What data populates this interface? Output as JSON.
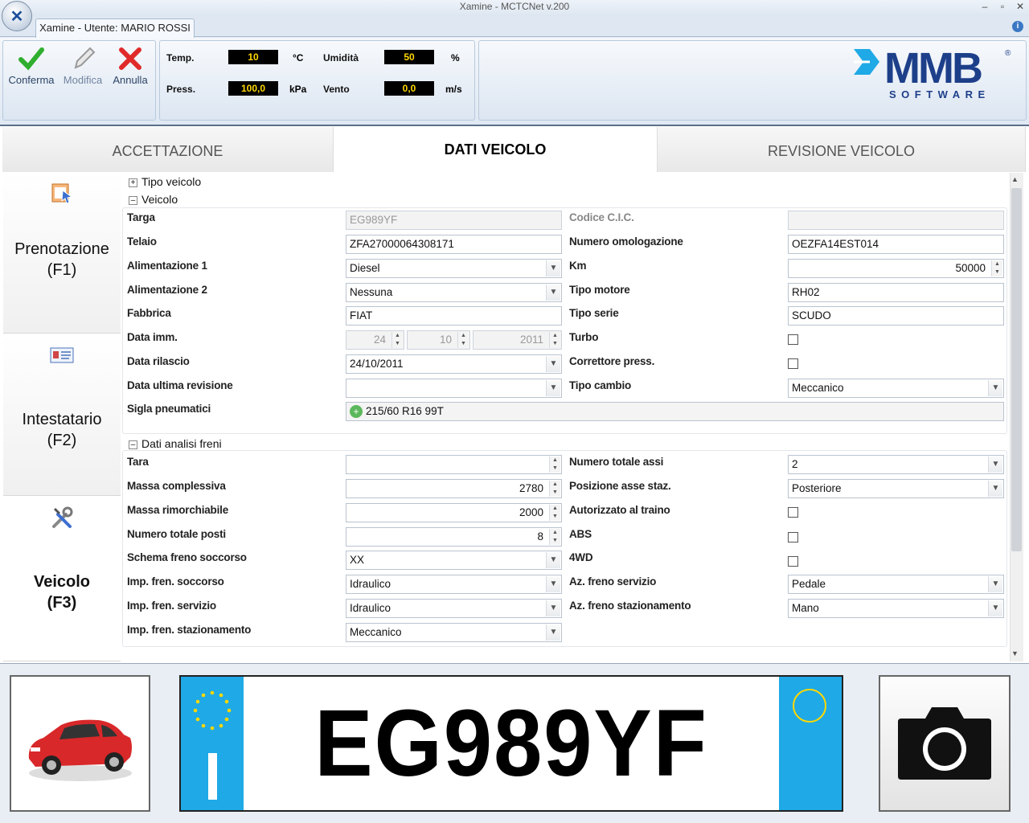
{
  "window": {
    "title": "Xamine - MCTCNet v.200",
    "user_tab": "Xamine - Utente: MARIO ROSSI"
  },
  "ribbon": {
    "confirm_label": "Conferma",
    "edit_label": "Modifica",
    "cancel_label": "Annulla",
    "temp_label": "Temp.",
    "temp_value": "10",
    "temp_unit": "°C",
    "press_label": "Press.",
    "press_value": "100,0",
    "press_unit": "kPa",
    "humidity_label": "Umidità",
    "humidity_value": "50",
    "humidity_unit": "%",
    "wind_label": "Vento",
    "wind_value": "0,0",
    "wind_unit": "m/s"
  },
  "logo": {
    "brand": "MMB",
    "sub": "SOFTWARE"
  },
  "tabs": [
    "ACCETTAZIONE",
    "DATI VEICOLO",
    "REVISIONE VEICOLO"
  ],
  "side": {
    "item1_line1": "Prenotazione",
    "item1_line2": "(F1)",
    "item2_line1": "Intestatario",
    "item2_line2": "(F2)",
    "item3_line1": "Veicolo",
    "item3_line2": "(F3)"
  },
  "sections": {
    "tipo_veicolo": "Tipo veicolo",
    "veicolo": "Veicolo",
    "freni": "Dati analisi freni"
  },
  "veicolo": {
    "targa_label": "Targa",
    "targa": "EG989YF",
    "telaio_label": "Telaio",
    "telaio": "ZFA27000064308171",
    "alim1_label": "Alimentazione 1",
    "alim1": "Diesel",
    "alim2_label": "Alimentazione 2",
    "alim2": "Nessuna",
    "fabbrica_label": "Fabbrica",
    "fabbrica": "FIAT",
    "data_imm_label": "Data imm.",
    "data_imm_d": "24",
    "data_imm_m": "10",
    "data_imm_y": "2011",
    "data_ril_label": "Data rilascio",
    "data_ril": "24/10/2011",
    "data_rev_label": "Data ultima revisione",
    "data_rev": "",
    "pneumatici_label": "Sigla pneumatici",
    "pneumatici": "215/60 R16 99T",
    "cic_label": "Codice C.I.C.",
    "cic": "",
    "omolog_label": "Numero omologazione",
    "omolog": "OEZFA14EST014",
    "km_label": "Km",
    "km": "50000",
    "motore_label": "Tipo motore",
    "motore": "RH02",
    "serie_label": "Tipo serie",
    "serie": "SCUDO",
    "turbo_label": "Turbo",
    "correttore_label": "Correttore press.",
    "cambio_label": "Tipo cambio",
    "cambio": "Meccanico"
  },
  "freni": {
    "tara_label": "Tara",
    "tara": "",
    "massa_label": "Massa complessiva",
    "massa": "2780",
    "rimorch_label": "Massa rimorchiabile",
    "rimorch": "2000",
    "posti_label": "Numero totale posti",
    "posti": "8",
    "schema_label": "Schema freno soccorso",
    "schema": "XX",
    "imp_socc_label": "Imp. fren. soccorso",
    "imp_socc": "Idraulico",
    "imp_serv_label": "Imp. fren. servizio",
    "imp_serv": "Idraulico",
    "imp_staz_label": "Imp. fren. stazionamento",
    "imp_staz": "Meccanico",
    "assi_label": "Numero totale assi",
    "assi": "2",
    "pos_asse_label": "Posizione asse staz.",
    "pos_asse": "Posteriore",
    "traino_label": "Autorizzato al traino",
    "abs_label": "ABS",
    "wd_label": "4WD",
    "az_serv_label": "Az. freno servizio",
    "az_serv": "Pedale",
    "az_staz_label": "Az. freno stazionamento",
    "az_staz": "Mano"
  },
  "plate": {
    "text": "EG989YF",
    "country": "I"
  }
}
